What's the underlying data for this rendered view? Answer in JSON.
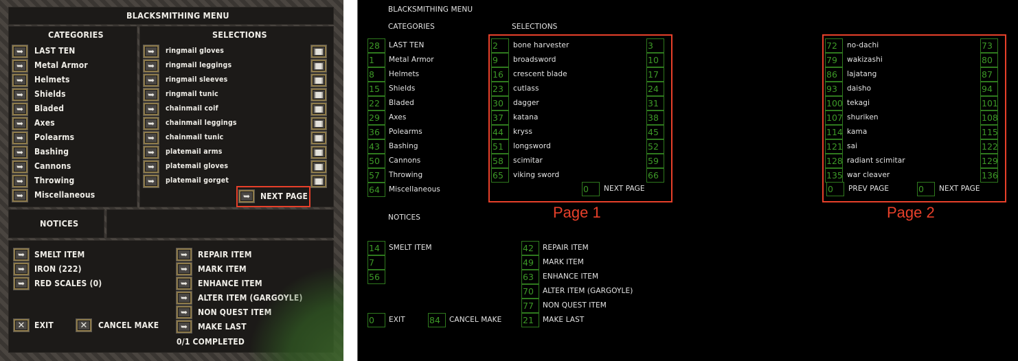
{
  "gump": {
    "title": "BLACKSMITHING MENU",
    "categories_header": "CATEGORIES",
    "selections_header": "SELECTIONS",
    "notices_header": "NOTICES",
    "categories": [
      "LAST TEN",
      "Metal Armor",
      "Helmets",
      "Shields",
      "Bladed",
      "Axes",
      "Polearms",
      "Bashing",
      "Cannons",
      "Throwing",
      "Miscellaneous"
    ],
    "selections": [
      "ringmail  gloves",
      "ringmail  leggings",
      "ringmail  sleeves",
      "ringmail  tunic",
      "chainmail  coif",
      "chainmail  leggings",
      "chainmail  tunic",
      "platemail  arms",
      "platemail  gloves",
      "platemail  gorget"
    ],
    "next_page": "NEXT PAGE",
    "left_actions": [
      "SMELT ITEM",
      "IRON (222)",
      "RED SCALES (0)"
    ],
    "right_actions": [
      "REPAIR ITEM",
      "MARK ITEM",
      "ENHANCE ITEM",
      "ALTER ITEM (GARGOYLE)",
      "NON QUEST ITEM",
      "MAKE LAST"
    ],
    "exit": "EXIT",
    "cancel_make": "CANCEL MAKE",
    "completed": "0/1 COMPLETED"
  },
  "map": {
    "title": "BLACKSMITHING MENU",
    "categories_header": "CATEGORIES",
    "selections_header": "SELECTIONS",
    "notices_header": "NOTICES",
    "categories": [
      {
        "id": "28",
        "label": "LAST TEN"
      },
      {
        "id": "1",
        "label": "Metal Armor"
      },
      {
        "id": "8",
        "label": "Helmets"
      },
      {
        "id": "15",
        "label": "Shields"
      },
      {
        "id": "22",
        "label": "Bladed"
      },
      {
        "id": "29",
        "label": "Axes"
      },
      {
        "id": "36",
        "label": "Polearms"
      },
      {
        "id": "43",
        "label": "Bashing"
      },
      {
        "id": "50",
        "label": "Cannons"
      },
      {
        "id": "57",
        "label": "Throwing"
      },
      {
        "id": "64",
        "label": "Miscellaneous"
      }
    ],
    "page1": {
      "label": "Page 1",
      "items": [
        {
          "id": "2",
          "label": "bone harvester",
          "info": "3"
        },
        {
          "id": "9",
          "label": "broadsword",
          "info": "10"
        },
        {
          "id": "16",
          "label": "crescent blade",
          "info": "17"
        },
        {
          "id": "23",
          "label": "cutlass",
          "info": "24"
        },
        {
          "id": "30",
          "label": "dagger",
          "info": "31"
        },
        {
          "id": "37",
          "label": "katana",
          "info": "38"
        },
        {
          "id": "44",
          "label": "kryss",
          "info": "45"
        },
        {
          "id": "51",
          "label": "longsword",
          "info": "52"
        },
        {
          "id": "58",
          "label": "scimitar",
          "info": "59"
        },
        {
          "id": "65",
          "label": "viking sword",
          "info": "66"
        }
      ],
      "next_id": "0",
      "next_label": "NEXT PAGE"
    },
    "page2": {
      "label": "Page 2",
      "items": [
        {
          "id": "72",
          "label": "no-dachi",
          "info": "73"
        },
        {
          "id": "79",
          "label": "wakizashi",
          "info": "80"
        },
        {
          "id": "86",
          "label": "lajatang",
          "info": "87"
        },
        {
          "id": "93",
          "label": "daisho",
          "info": "94"
        },
        {
          "id": "100",
          "label": "tekagi",
          "info": "101"
        },
        {
          "id": "107",
          "label": "shuriken",
          "info": "108"
        },
        {
          "id": "114",
          "label": "kama",
          "info": "115"
        },
        {
          "id": "121",
          "label": "sai",
          "info": "122"
        },
        {
          "id": "128",
          "label": "radiant scimitar",
          "info": "129"
        },
        {
          "id": "135",
          "label": "war cleaver",
          "info": "136"
        }
      ],
      "prev_id": "0",
      "prev_label": "PREV PAGE",
      "next_id": "0",
      "next_label": "NEXT PAGE"
    },
    "left_actions": [
      {
        "id": "14",
        "label": "SMELT ITEM"
      },
      {
        "id": "7",
        "label": ""
      },
      {
        "id": "56",
        "label": ""
      }
    ],
    "right_actions": [
      {
        "id": "42",
        "label": "REPAIR ITEM"
      },
      {
        "id": "49",
        "label": "MARK ITEM"
      },
      {
        "id": "63",
        "label": "ENHANCE ITEM"
      },
      {
        "id": "70",
        "label": "ALTER ITEM (GARGOYLE)"
      },
      {
        "id": "77",
        "label": "NON QUEST ITEM"
      },
      {
        "id": "21",
        "label": "MAKE LAST"
      }
    ],
    "exit": {
      "id": "0",
      "label": "EXIT"
    },
    "cancel_make": {
      "id": "84",
      "label": "CANCEL MAKE"
    }
  },
  "colors": {
    "highlight": "#e8402a",
    "id_box": "#3d9a27"
  }
}
